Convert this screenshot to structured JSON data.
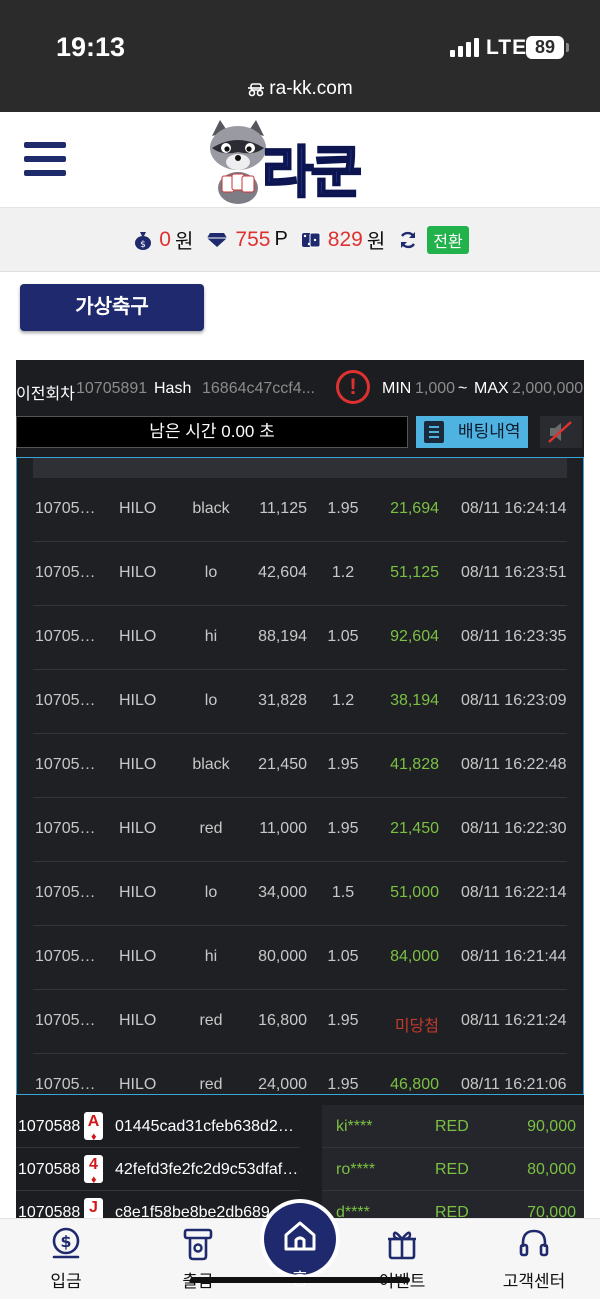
{
  "status_bar": {
    "time": "19:13",
    "network": "LTE",
    "battery": "89"
  },
  "browser": {
    "url": "ra-kk.com"
  },
  "header": {
    "logo_text": "라쿤"
  },
  "balance": {
    "cash_value": "0",
    "cash_unit": "원",
    "points_value": "755",
    "points_unit": "P",
    "game_money_value": "829",
    "game_money_unit": "원",
    "switch_label": "전환"
  },
  "virtual_soccer_label": "가상축구",
  "round_info": {
    "prev_round_label": "이전회차",
    "prev_round_value": "10705891",
    "hash_label": "Hash",
    "hash_value": "16864c47ccf4...",
    "min_label": "MIN",
    "min_value": "1,000",
    "tilde": "~",
    "max_label": "MAX",
    "max_value": "2,000,000"
  },
  "timer_text": "남은 시간 0.00 초",
  "bet_history_label": "배팅내역",
  "bets": [
    {
      "id": "10705…",
      "game": "HILO",
      "pick": "black",
      "amount": "11,125",
      "odds": "1.95",
      "win": "21,694",
      "time": "08/11 16:24:14"
    },
    {
      "id": "10705…",
      "game": "HILO",
      "pick": "lo",
      "amount": "42,604",
      "odds": "1.2",
      "win": "51,125",
      "time": "08/11 16:23:51"
    },
    {
      "id": "10705…",
      "game": "HILO",
      "pick": "hi",
      "amount": "88,194",
      "odds": "1.05",
      "win": "92,604",
      "time": "08/11 16:23:35"
    },
    {
      "id": "10705…",
      "game": "HILO",
      "pick": "lo",
      "amount": "31,828",
      "odds": "1.2",
      "win": "38,194",
      "time": "08/11 16:23:09"
    },
    {
      "id": "10705…",
      "game": "HILO",
      "pick": "black",
      "amount": "21,450",
      "odds": "1.95",
      "win": "41,828",
      "time": "08/11 16:22:48"
    },
    {
      "id": "10705…",
      "game": "HILO",
      "pick": "red",
      "amount": "11,000",
      "odds": "1.95",
      "win": "21,450",
      "time": "08/11 16:22:30"
    },
    {
      "id": "10705…",
      "game": "HILO",
      "pick": "lo",
      "amount": "34,000",
      "odds": "1.5",
      "win": "51,000",
      "time": "08/11 16:22:14"
    },
    {
      "id": "10705…",
      "game": "HILO",
      "pick": "hi",
      "amount": "80,000",
      "odds": "1.05",
      "win": "84,000",
      "time": "08/11 16:21:44"
    },
    {
      "id": "10705…",
      "game": "HILO",
      "pick": "red",
      "amount": "16,800",
      "odds": "1.95",
      "win": "미당첨",
      "time": "08/11 16:21:24"
    },
    {
      "id": "10705…",
      "game": "HILO",
      "pick": "red",
      "amount": "24,000",
      "odds": "1.95",
      "win": "46,800",
      "time": "08/11 16:21:06"
    }
  ],
  "history": [
    {
      "id": "1070588",
      "card": "A",
      "hash": "01445cad31cfeb638d2…",
      "user": "ki****",
      "pick": "RED",
      "amount": "90,000"
    },
    {
      "id": "1070588",
      "card": "4",
      "hash": "42fefd3fe2fc2d9c53dfaf…",
      "user": "ro****",
      "pick": "RED",
      "amount": "80,000"
    },
    {
      "id": "1070588",
      "card": "J",
      "hash": "c8e1f58be8be2db689…",
      "user": "d****",
      "pick": "RED",
      "amount": "70,000"
    }
  ],
  "bottom_nav": {
    "deposit": "입금",
    "withdraw": "출금",
    "home": "홈",
    "event": "이벤트",
    "support": "고객센터"
  },
  "colors": {
    "brand_navy": "#1f2a6e",
    "win_green": "#7bc043",
    "loss_red": "#c0392b",
    "accent_blue": "#4fb3e2"
  }
}
